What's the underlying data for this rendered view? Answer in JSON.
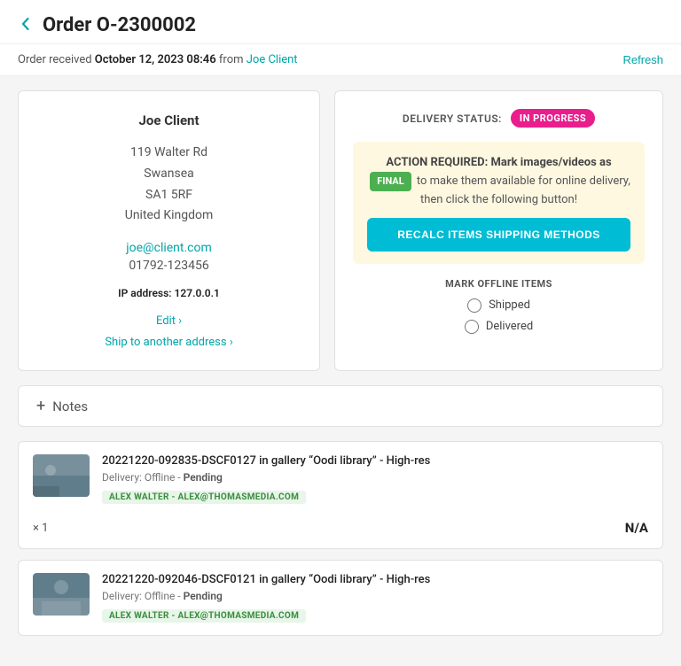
{
  "header": {
    "back_icon": "‹",
    "order_title": "Order O-2300002"
  },
  "subheader": {
    "received_text": "Order received",
    "date_strong": "October 12, 2023 08:46",
    "from_text": "from",
    "client_link": "Joe Client",
    "refresh_label": "Refresh"
  },
  "address_card": {
    "client_name": "Joe Client",
    "address_line1": "119 Walter Rd",
    "address_line2": "Swansea",
    "address_line3": "SA1 5RF",
    "address_line4": "United Kingdom",
    "email": "joe@client.com",
    "phone": "01792-123456",
    "ip_label": "IP address:",
    "ip_value": "127.0.0.1",
    "edit_label": "Edit ›",
    "ship_label": "Ship to another address ›"
  },
  "delivery_card": {
    "delivery_status_label": "DELIVERY STATUS:",
    "status_badge": "IN PROGRESS",
    "action_required_prefix": "ACTION REQUIRED: Mark images/videos as",
    "final_badge": "FINAL",
    "action_required_suffix": "to make them available for online delivery, then click the following button!",
    "recalc_label": "RECALC ITEMS SHIPPING METHODS",
    "offline_title": "MARK OFFLINE ITEMS",
    "shipped_label": "Shipped",
    "delivered_label": "Delivered"
  },
  "notes": {
    "plus_icon": "+",
    "label": "Notes"
  },
  "items": [
    {
      "title": "20221220-092835-DSCF0127 in gallery “Oodi library” - High-res",
      "delivery": "Delivery: Offline - ",
      "status": "Pending",
      "tag": "ALEX WALTER - ALEX@THOMASMEDIA.COM",
      "qty_label": "× 1",
      "price": "N/A",
      "thumb_color1": "#78909c",
      "thumb_color2": "#90a4ae"
    },
    {
      "title": "20221220-092046-DSCF0121 in gallery “Oodi library” - High-res",
      "delivery": "Delivery: Offline - ",
      "status": "Pending",
      "tag": "ALEX WALTER - ALEX@THOMASMEDIA.COM",
      "qty_label": "",
      "price": "",
      "thumb_color1": "#607d8b",
      "thumb_color2": "#b0bec5"
    }
  ]
}
